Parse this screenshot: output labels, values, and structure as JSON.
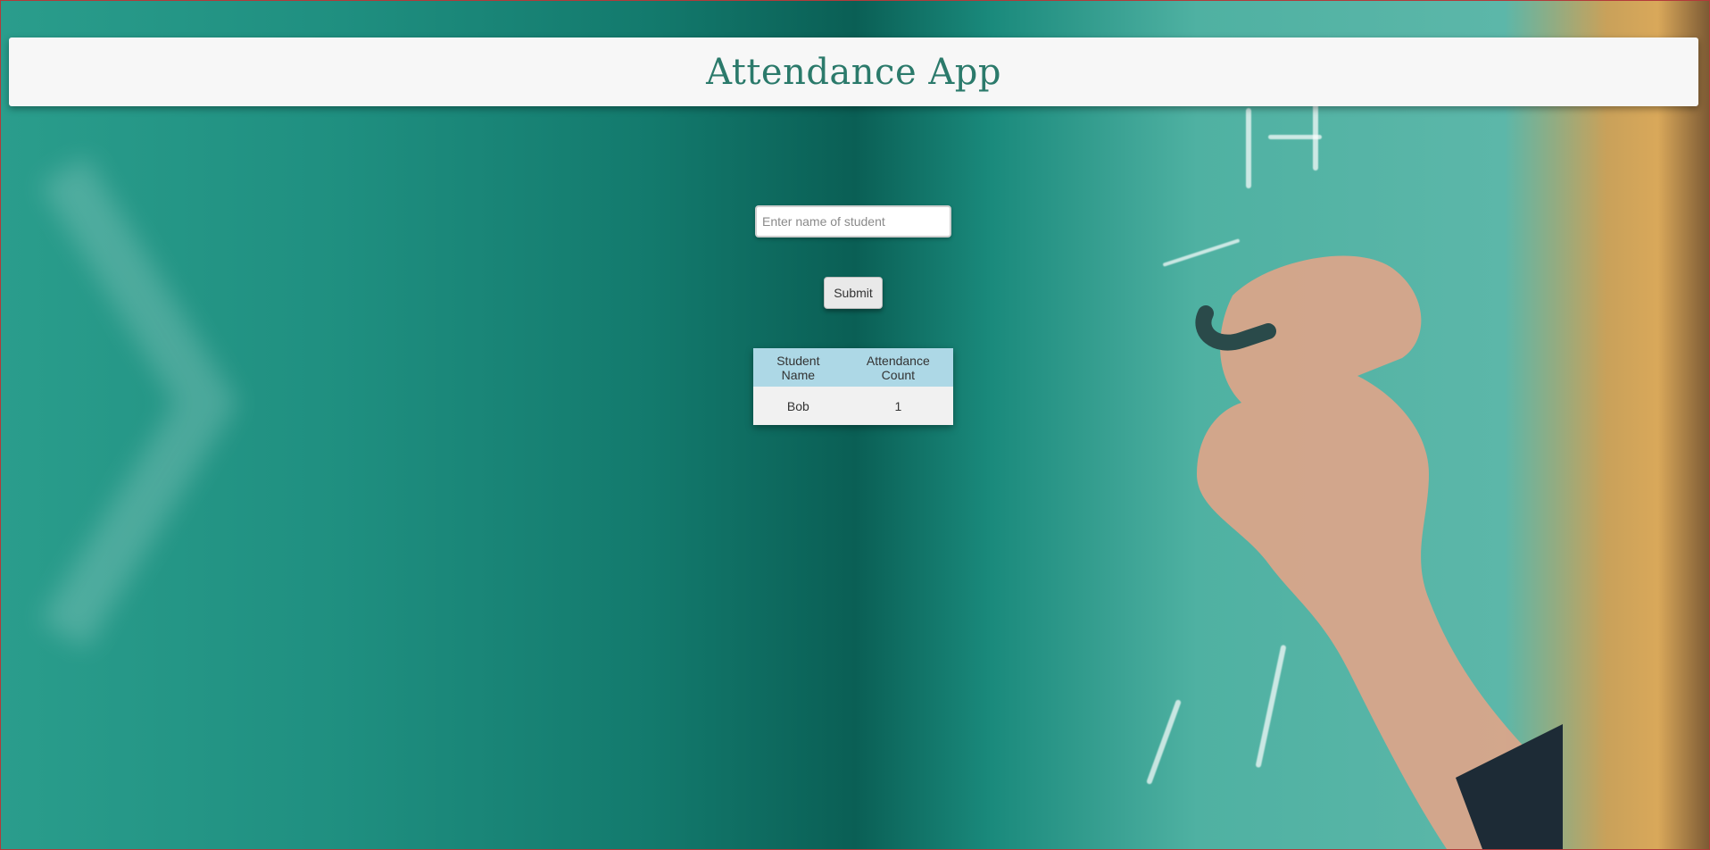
{
  "header": {
    "title": "Attendance App"
  },
  "form": {
    "name_placeholder": "Enter name of student",
    "name_value": "",
    "submit_label": "Submit"
  },
  "table": {
    "columns": [
      "Student Name",
      "Attendance Count"
    ],
    "rows": [
      {
        "name": "Bob",
        "count": "1"
      }
    ]
  },
  "colors": {
    "header_title": "#2b7a6b",
    "table_header_bg": "#add8e6",
    "chalkboard_green": "#2a9d8c"
  }
}
